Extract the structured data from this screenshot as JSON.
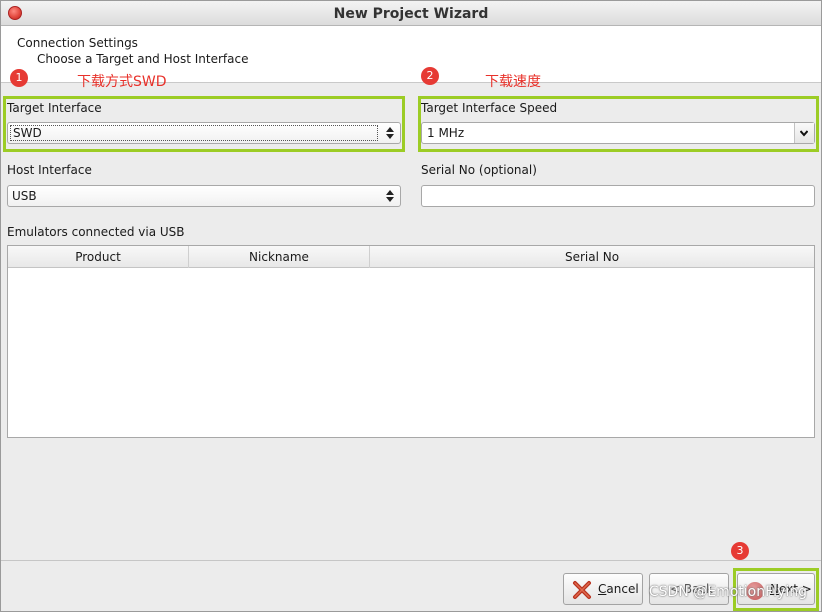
{
  "window": {
    "title": "New Project Wizard"
  },
  "header": {
    "title": "Connection Settings",
    "subtitle": "Choose a Target and Host Interface"
  },
  "annotations": {
    "badge1": "1",
    "badge1_text": "下载方式SWD",
    "badge2": "2",
    "badge2_text": "下载速度",
    "badge3": "3"
  },
  "target_interface": {
    "label": "Target Interface",
    "value": "SWD"
  },
  "target_speed": {
    "label": "Target Interface Speed",
    "value": "1 MHz"
  },
  "host_interface": {
    "label": "Host Interface",
    "value": "USB"
  },
  "serial_no": {
    "label": "Serial No (optional)",
    "value": ""
  },
  "emulators": {
    "label": "Emulators connected via USB",
    "columns": [
      "Product",
      "Nickname",
      "Serial No"
    ]
  },
  "footer": {
    "cancel_rest": "ancel",
    "cancel_mnemonic": "C",
    "back_label": "< Back",
    "next_pre": "",
    "next_mnemonic": "N",
    "next_rest": "ext >"
  },
  "watermark": "CSDN @EmotionFlying",
  "colors": {
    "highlight": "#9ccc25",
    "badge": "#e63a34",
    "annotation_text": "#e8312a"
  }
}
